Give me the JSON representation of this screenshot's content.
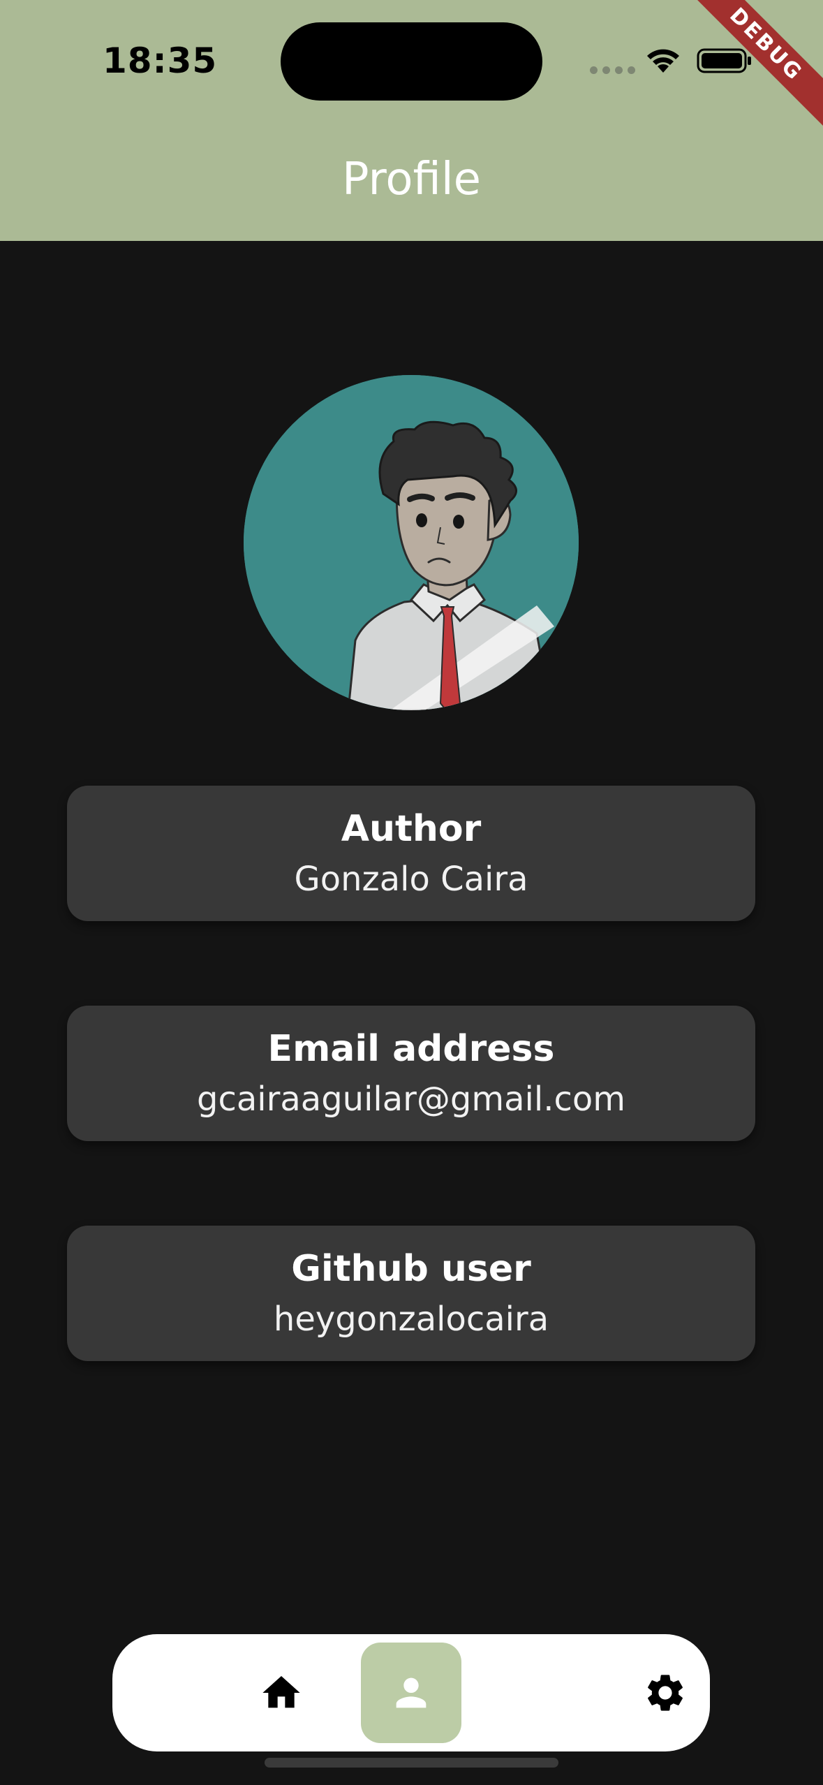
{
  "status_bar": {
    "time": "18:35",
    "debug_label": "DEBUG"
  },
  "app_bar": {
    "title": "Profile",
    "background_color": "#abba95"
  },
  "profile": {
    "cards": [
      {
        "label": "Author",
        "value": "Gonzalo Caira"
      },
      {
        "label": "Email address",
        "value": "gcairaaguilar@gmail.com"
      },
      {
        "label": "Github user",
        "value": "heygonzalocaira"
      }
    ]
  },
  "bottom_nav": {
    "items": [
      {
        "icon": "home-icon",
        "active": false
      },
      {
        "icon": "person-icon",
        "active": true
      },
      {
        "icon": "gear-icon",
        "active": false
      }
    ],
    "active_color": "#bccca6"
  },
  "colors": {
    "page_background": "#141414",
    "card_background": "#383838",
    "avatar_background": "#3d8b89"
  }
}
